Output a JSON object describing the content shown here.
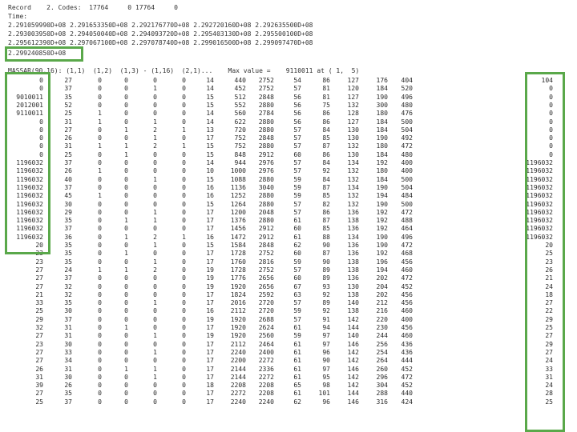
{
  "header": {
    "record_line": "Record    2. Codes:  17764     0 17764     0",
    "time_label": "Time:",
    "time_lines": [
      "2.291059990D+08 2.291653350D+08 2.292176770D+08 2.292720160D+08 2.292635500D+08",
      "2.293003950D+08 2.294050040D+08 2.294093720D+08 2.295403130D+08 2.295500100D+08",
      "2.295612390D+08 2.297067100D+08 2.297078740D+08 2.299016500D+08 2.299097470D+08"
    ],
    "highlighted_time": "2.299240850D+08",
    "array_line": "MASSAR(90,16): (1,1)  (1,2)  (1,3) - (1,16)  (2,1)...    Max value =    9110011 at ( 1,  5)"
  },
  "table": {
    "rows": [
      [
        "0",
        "27",
        "0",
        "0",
        "0",
        "0",
        "14",
        "440",
        "2752",
        "54",
        "86",
        "127",
        "176",
        "404",
        "104"
      ],
      [
        "0",
        "37",
        "0",
        "0",
        "1",
        "0",
        "14",
        "452",
        "2752",
        "57",
        "81",
        "120",
        "184",
        "520",
        "0"
      ],
      [
        "9010011",
        "35",
        "0",
        "0",
        "0",
        "0",
        "15",
        "512",
        "2848",
        "56",
        "81",
        "127",
        "190",
        "496",
        "0"
      ],
      [
        "2012001",
        "52",
        "0",
        "0",
        "0",
        "0",
        "15",
        "552",
        "2880",
        "56",
        "75",
        "132",
        "300",
        "480",
        "0"
      ],
      [
        "9110011",
        "25",
        "1",
        "0",
        "0",
        "0",
        "14",
        "560",
        "2784",
        "56",
        "86",
        "128",
        "180",
        "476",
        "0"
      ],
      [
        "0",
        "31",
        "1",
        "0",
        "1",
        "0",
        "14",
        "622",
        "2880",
        "56",
        "86",
        "127",
        "184",
        "500",
        "0"
      ],
      [
        "0",
        "27",
        "0",
        "1",
        "2",
        "1",
        "13",
        "720",
        "2880",
        "57",
        "84",
        "130",
        "184",
        "504",
        "0"
      ],
      [
        "0",
        "26",
        "0",
        "0",
        "1",
        "0",
        "17",
        "752",
        "2848",
        "57",
        "85",
        "130",
        "190",
        "492",
        "0"
      ],
      [
        "0",
        "31",
        "1",
        "1",
        "2",
        "1",
        "15",
        "752",
        "2880",
        "57",
        "87",
        "132",
        "180",
        "472",
        "0"
      ],
      [
        "0",
        "25",
        "0",
        "1",
        "0",
        "0",
        "15",
        "848",
        "2912",
        "60",
        "86",
        "130",
        "184",
        "480",
        "0"
      ],
      [
        "1196032",
        "37",
        "0",
        "0",
        "0",
        "0",
        "14",
        "944",
        "2976",
        "57",
        "84",
        "134",
        "192",
        "400",
        "1196032"
      ],
      [
        "1196032",
        "26",
        "1",
        "0",
        "0",
        "0",
        "10",
        "1000",
        "2976",
        "57",
        "92",
        "132",
        "180",
        "400",
        "1196032"
      ],
      [
        "1196032",
        "40",
        "0",
        "0",
        "1",
        "0",
        "15",
        "1088",
        "2880",
        "59",
        "84",
        "132",
        "184",
        "500",
        "1196032"
      ],
      [
        "1196032",
        "37",
        "0",
        "0",
        "0",
        "0",
        "16",
        "1136",
        "3040",
        "59",
        "87",
        "134",
        "190",
        "504",
        "1196032"
      ],
      [
        "1196032",
        "45",
        "1",
        "0",
        "0",
        "0",
        "16",
        "1252",
        "2880",
        "59",
        "85",
        "132",
        "194",
        "484",
        "1196032"
      ],
      [
        "1196032",
        "30",
        "0",
        "0",
        "0",
        "0",
        "15",
        "1264",
        "2880",
        "57",
        "82",
        "132",
        "190",
        "500",
        "1196032"
      ],
      [
        "1196032",
        "29",
        "0",
        "0",
        "1",
        "0",
        "17",
        "1200",
        "2048",
        "57",
        "86",
        "136",
        "192",
        "472",
        "1196032"
      ],
      [
        "1196032",
        "35",
        "0",
        "1",
        "1",
        "0",
        "17",
        "1376",
        "2880",
        "61",
        "87",
        "138",
        "192",
        "488",
        "1196032"
      ],
      [
        "1196032",
        "37",
        "0",
        "0",
        "0",
        "0",
        "17",
        "1456",
        "2912",
        "60",
        "85",
        "136",
        "192",
        "464",
        "1196032"
      ],
      [
        "1196032",
        "36",
        "0",
        "1",
        "2",
        "1",
        "16",
        "1472",
        "2912",
        "61",
        "88",
        "134",
        "190",
        "496",
        "1196032"
      ],
      [
        "20",
        "35",
        "0",
        "0",
        "1",
        "0",
        "15",
        "1584",
        "2848",
        "62",
        "90",
        "136",
        "190",
        "472",
        "20"
      ],
      [
        "23",
        "35",
        "0",
        "1",
        "0",
        "0",
        "17",
        "1728",
        "2752",
        "60",
        "87",
        "136",
        "192",
        "468",
        "25"
      ],
      [
        "23",
        "35",
        "0",
        "0",
        "1",
        "0",
        "17",
        "1760",
        "2816",
        "59",
        "90",
        "138",
        "196",
        "456",
        "23"
      ],
      [
        "27",
        "24",
        "1",
        "1",
        "2",
        "0",
        "19",
        "1728",
        "2752",
        "57",
        "89",
        "138",
        "194",
        "460",
        "26"
      ],
      [
        "27",
        "37",
        "0",
        "0",
        "0",
        "0",
        "19",
        "1776",
        "2656",
        "60",
        "89",
        "136",
        "202",
        "472",
        "21"
      ],
      [
        "27",
        "32",
        "0",
        "0",
        "0",
        "0",
        "19",
        "1920",
        "2656",
        "67",
        "93",
        "130",
        "204",
        "452",
        "24"
      ],
      [
        "21",
        "32",
        "0",
        "0",
        "0",
        "0",
        "17",
        "1824",
        "2592",
        "63",
        "92",
        "138",
        "202",
        "456",
        "18"
      ],
      [
        "33",
        "35",
        "0",
        "0",
        "1",
        "0",
        "17",
        "2016",
        "2720",
        "57",
        "89",
        "140",
        "212",
        "456",
        "27"
      ],
      [
        "25",
        "30",
        "0",
        "0",
        "0",
        "0",
        "16",
        "2112",
        "2720",
        "59",
        "92",
        "138",
        "216",
        "460",
        "22"
      ],
      [
        "29",
        "37",
        "0",
        "0",
        "0",
        "0",
        "19",
        "1920",
        "2688",
        "57",
        "91",
        "142",
        "220",
        "400",
        "29"
      ],
      [
        "32",
        "31",
        "0",
        "1",
        "0",
        "0",
        "17",
        "1920",
        "2624",
        "61",
        "94",
        "144",
        "230",
        "456",
        "25"
      ],
      [
        "27",
        "31",
        "0",
        "0",
        "1",
        "0",
        "19",
        "1920",
        "2560",
        "59",
        "97",
        "140",
        "244",
        "460",
        "27"
      ],
      [
        "23",
        "30",
        "0",
        "0",
        "0",
        "0",
        "17",
        "2112",
        "2464",
        "61",
        "97",
        "146",
        "256",
        "436",
        "29"
      ],
      [
        "27",
        "33",
        "0",
        "0",
        "1",
        "0",
        "17",
        "2240",
        "2400",
        "61",
        "96",
        "142",
        "254",
        "436",
        "27"
      ],
      [
        "27",
        "34",
        "0",
        "0",
        "0",
        "0",
        "17",
        "2200",
        "2272",
        "61",
        "90",
        "142",
        "264",
        "444",
        "24"
      ],
      [
        "26",
        "31",
        "0",
        "1",
        "1",
        "0",
        "17",
        "2144",
        "2336",
        "61",
        "97",
        "146",
        "260",
        "452",
        "33"
      ],
      [
        "31",
        "30",
        "0",
        "0",
        "1",
        "0",
        "17",
        "2144",
        "2272",
        "61",
        "95",
        "142",
        "296",
        "472",
        "31"
      ],
      [
        "39",
        "26",
        "0",
        "0",
        "0",
        "0",
        "18",
        "2208",
        "2208",
        "65",
        "98",
        "142",
        "304",
        "452",
        "24"
      ],
      [
        "27",
        "35",
        "0",
        "0",
        "0",
        "0",
        "17",
        "2272",
        "2208",
        "61",
        "101",
        "144",
        "288",
        "440",
        "28"
      ],
      [
        "25",
        "37",
        "0",
        "0",
        "0",
        "0",
        "17",
        "2240",
        "2240",
        "62",
        "96",
        "146",
        "316",
        "424",
        "25"
      ]
    ]
  }
}
